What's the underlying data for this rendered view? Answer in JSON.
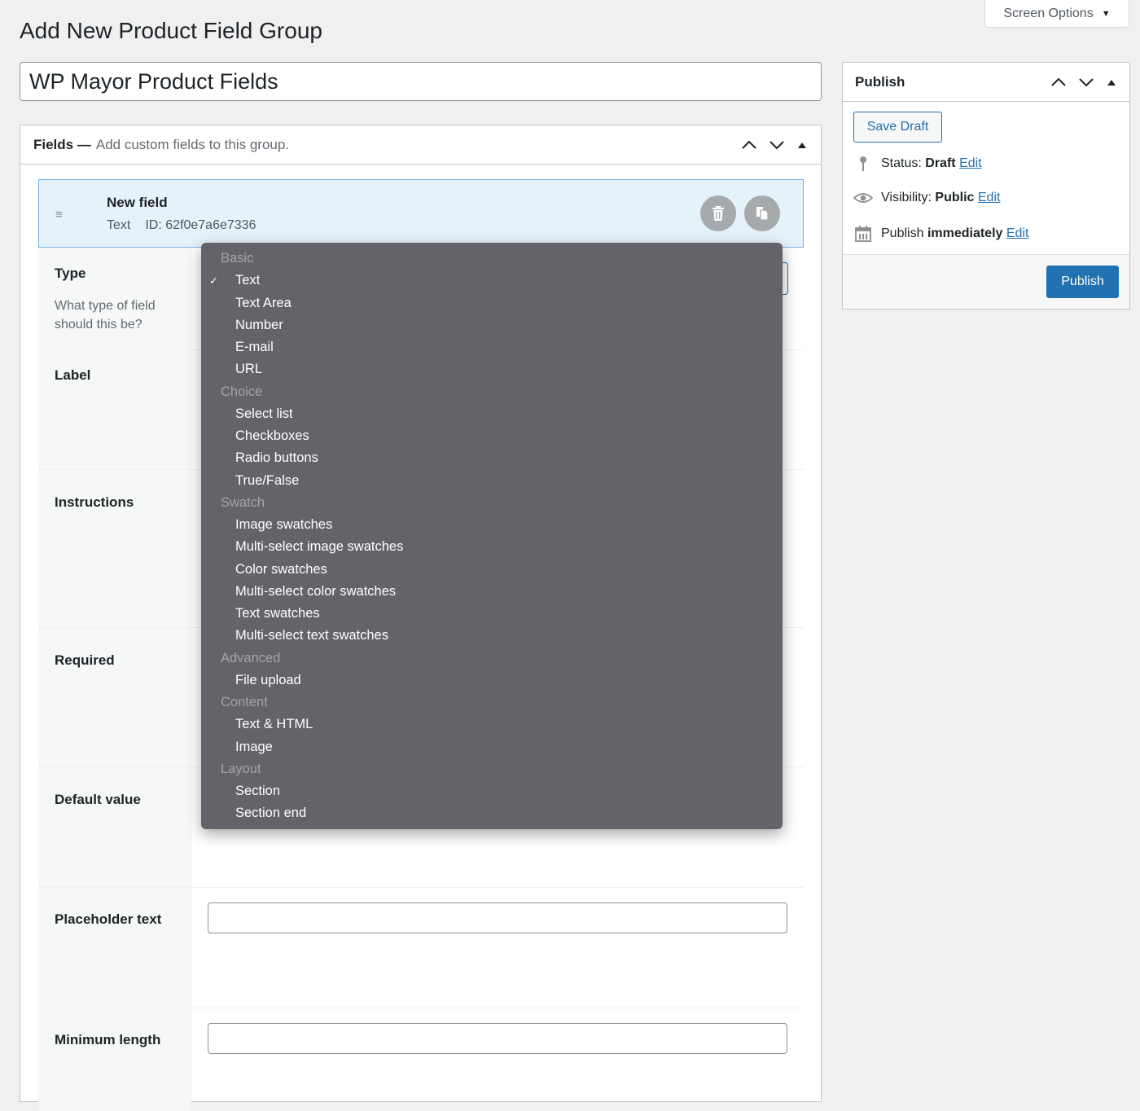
{
  "screen_options": {
    "label": "Screen Options"
  },
  "page": {
    "title": "Add New Product Field Group"
  },
  "title_input": {
    "value": "WP Mayor Product Fields"
  },
  "fields_box": {
    "title": "Fields —",
    "description": "Add custom fields to this group.",
    "field": {
      "name": "New field",
      "type": "Text",
      "id": "ID: 62f0e7a6e7336"
    },
    "settings": {
      "type_label": "Type",
      "type_desc": "What type of field should this be?",
      "label_label": "Label",
      "instructions_label": "Instructions",
      "required_label": "Required",
      "default_label": "Default value",
      "placeholder_label": "Placeholder text",
      "minlength_label": "Minimum length"
    }
  },
  "publish_box": {
    "title": "Publish",
    "save_draft": "Save Draft",
    "status_label": "Status:",
    "status_value": "Draft",
    "visibility_label": "Visibility:",
    "visibility_value": "Public",
    "publish_label": "Publish",
    "publish_value": "immediately",
    "edit_link": "Edit",
    "publish_button": "Publish"
  },
  "type_dropdown": {
    "selected": "Text",
    "entries": [
      {
        "kind": "group",
        "label": "Basic"
      },
      {
        "kind": "item",
        "label": "Text",
        "checked": true
      },
      {
        "kind": "item",
        "label": "Text Area"
      },
      {
        "kind": "item",
        "label": "Number"
      },
      {
        "kind": "item",
        "label": "E-mail"
      },
      {
        "kind": "item",
        "label": "URL"
      },
      {
        "kind": "group",
        "label": "Choice"
      },
      {
        "kind": "item",
        "label": "Select list"
      },
      {
        "kind": "item",
        "label": "Checkboxes"
      },
      {
        "kind": "item",
        "label": "Radio buttons"
      },
      {
        "kind": "item",
        "label": "True/False"
      },
      {
        "kind": "group",
        "label": "Swatch"
      },
      {
        "kind": "item",
        "label": "Image swatches"
      },
      {
        "kind": "item",
        "label": "Multi-select image swatches"
      },
      {
        "kind": "item",
        "label": "Color swatches"
      },
      {
        "kind": "item",
        "label": "Multi-select color swatches"
      },
      {
        "kind": "item",
        "label": "Text swatches"
      },
      {
        "kind": "item",
        "label": "Multi-select text swatches"
      },
      {
        "kind": "group",
        "label": "Advanced"
      },
      {
        "kind": "item",
        "label": "File upload"
      },
      {
        "kind": "group",
        "label": "Content"
      },
      {
        "kind": "item",
        "label": "Text & HTML"
      },
      {
        "kind": "item",
        "label": "Image"
      },
      {
        "kind": "group",
        "label": "Layout"
      },
      {
        "kind": "item",
        "label": "Section"
      },
      {
        "kind": "item",
        "label": "Section end"
      }
    ]
  },
  "colors": {
    "accent": "#2271b1",
    "field_highlight": "#e5f2f9",
    "dropdown_bg": "#64636a"
  }
}
